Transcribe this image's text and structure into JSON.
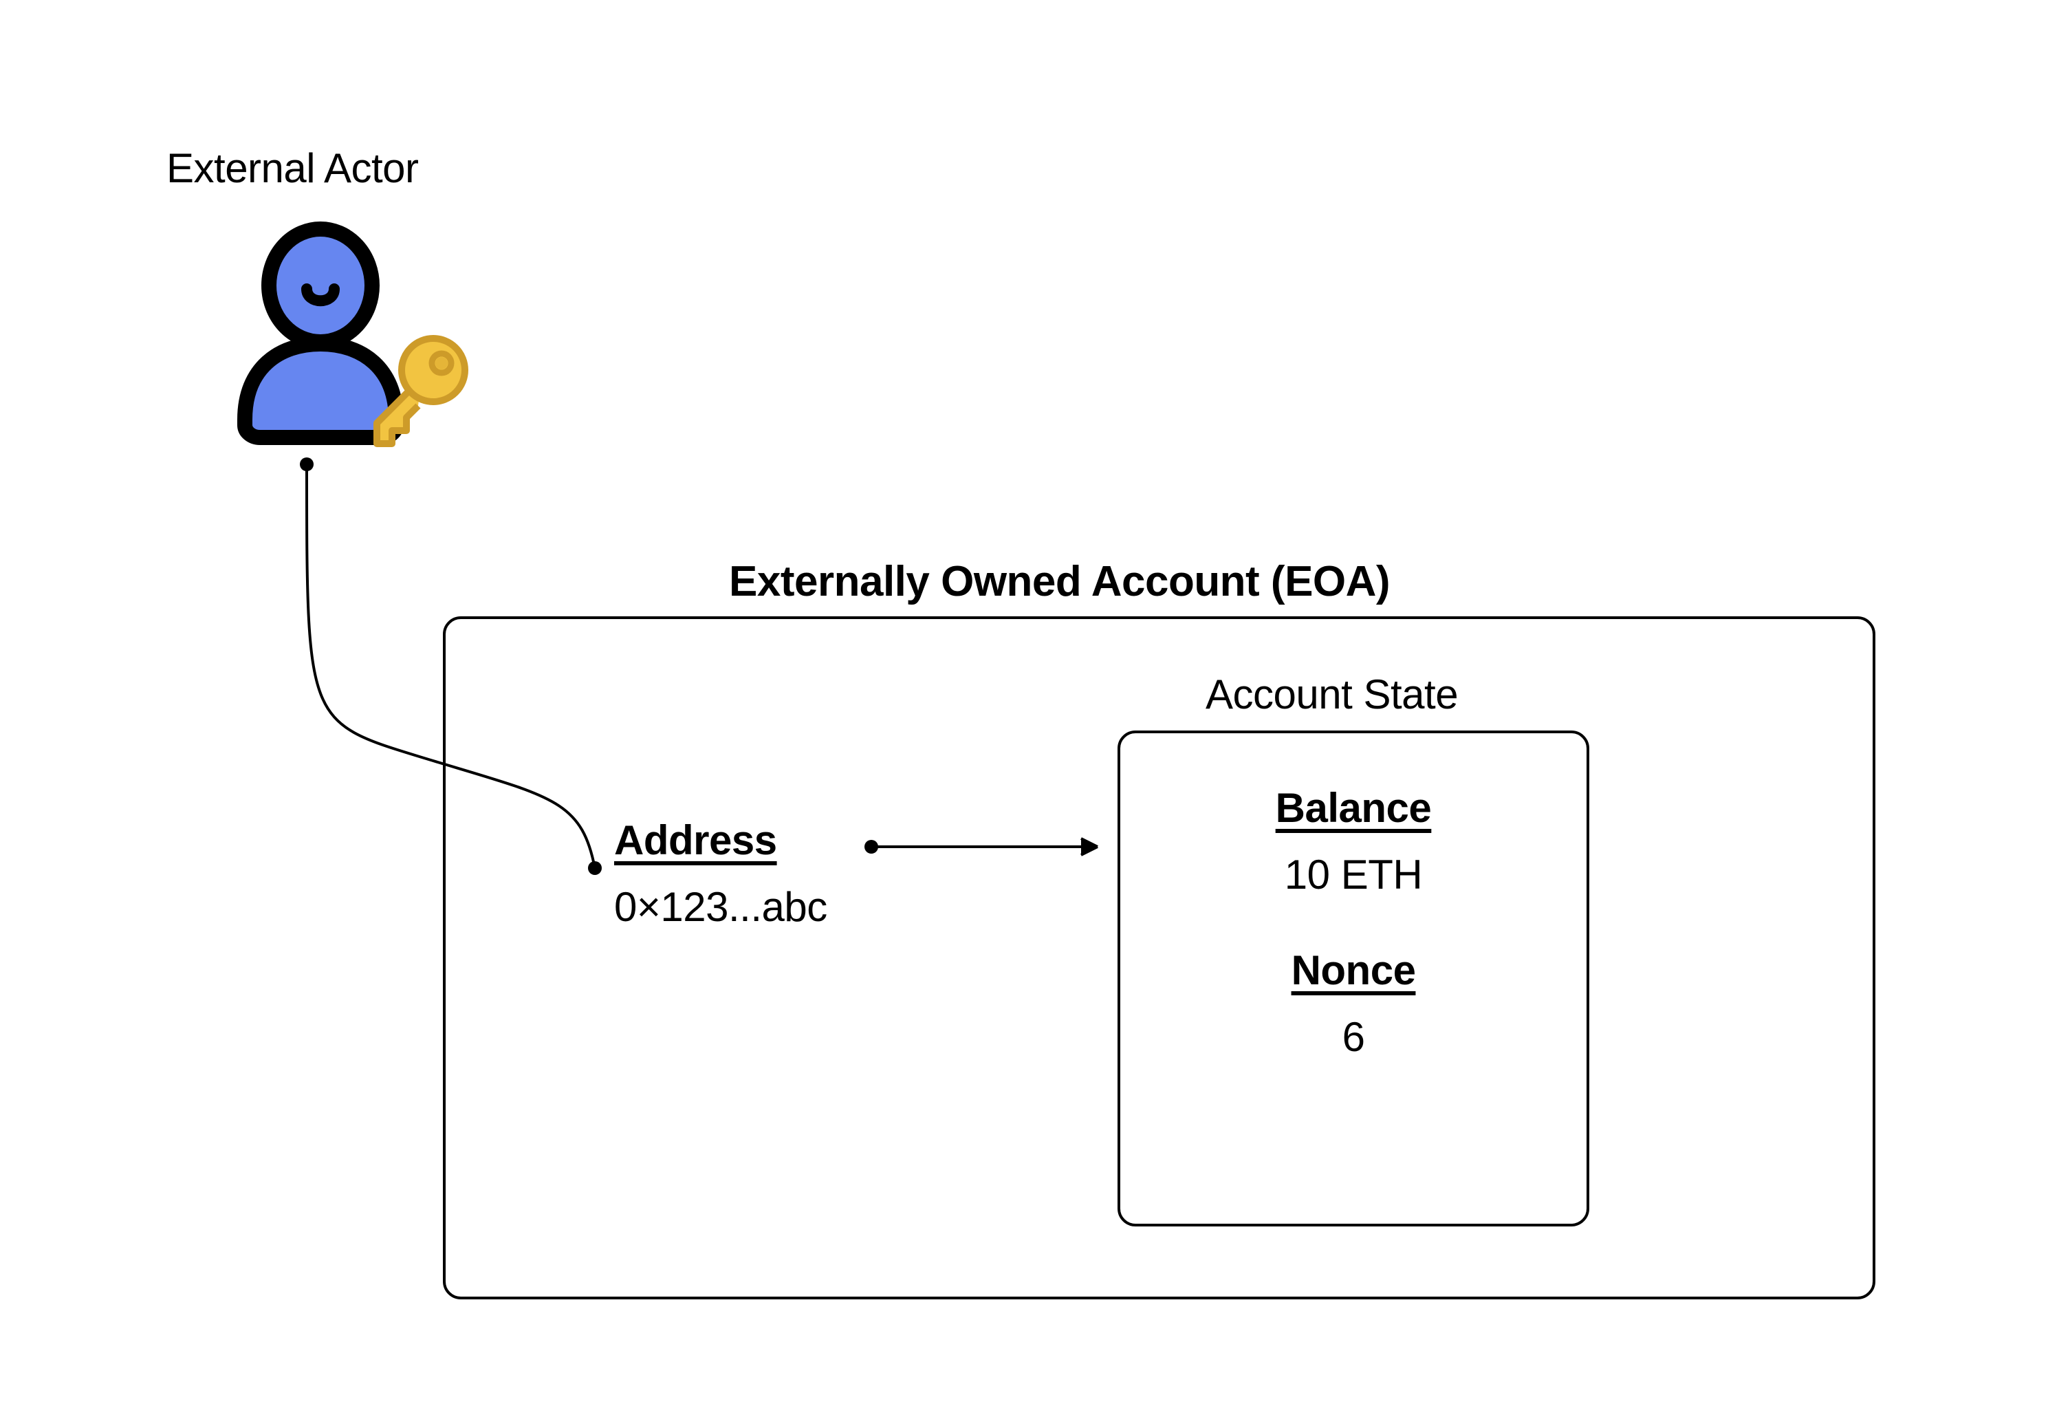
{
  "actor": {
    "label": "External Actor"
  },
  "eoa": {
    "title": "Externally Owned Account (EOA)",
    "address": {
      "label": "Address",
      "value": "0×123...abc"
    },
    "state": {
      "title": "Account State",
      "balance": {
        "label": "Balance",
        "value": "10 ETH"
      },
      "nonce": {
        "label": "Nonce",
        "value": "6"
      }
    }
  },
  "colors": {
    "actor_body": "#6686f0",
    "actor_stroke": "#000000",
    "key_fill": "#f2c441",
    "key_stroke": "#cd9b29"
  }
}
